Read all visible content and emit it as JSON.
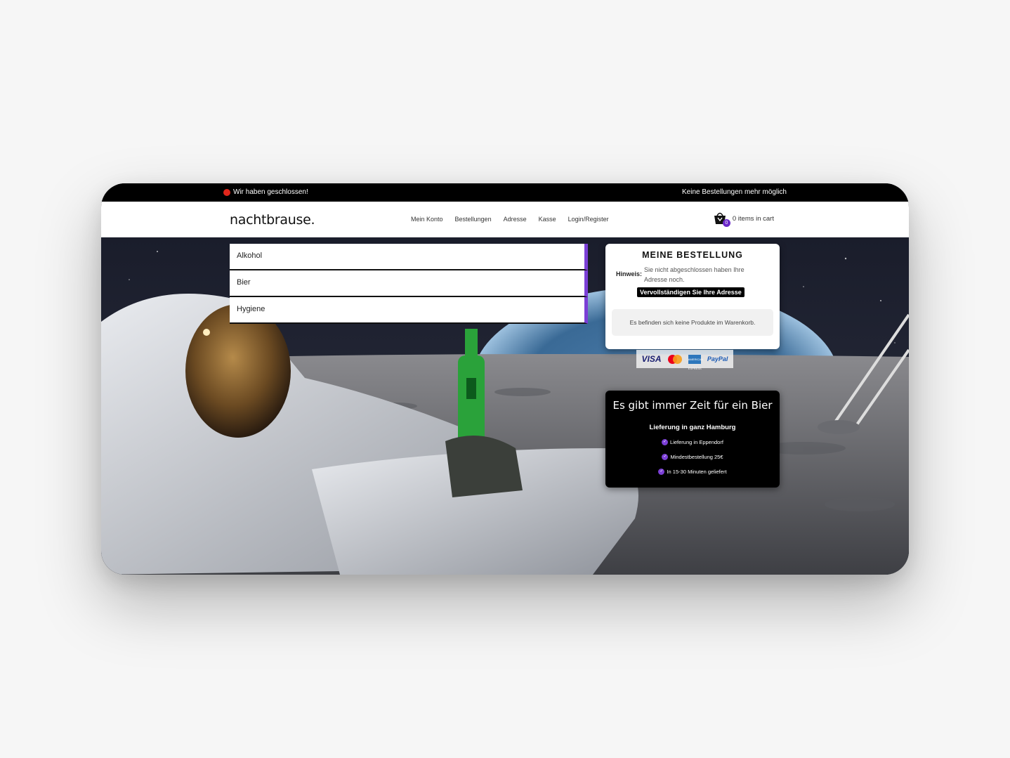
{
  "topbar": {
    "status": "Wir haben geschlossen!",
    "notice": "Keine Bestellungen mehr möglich"
  },
  "header": {
    "logo": "nachtbrause.",
    "nav": [
      "Mein Konto",
      "Bestellungen",
      "Adresse",
      "Kasse",
      "Login/Register"
    ],
    "cart": {
      "count": "0",
      "label": "0 items in cart"
    }
  },
  "categories": [
    "Alkohol",
    "Bier",
    "Hygiene"
  ],
  "order": {
    "title": "MEINE BESTELLUNG",
    "hint_label": "Hinweis:",
    "hint_text": "Sie nicht abgeschlossen haben Ihre Adresse noch.",
    "button": "Vervollständigen Sie Ihre Adresse",
    "empty": "Es befinden sich keine Produkte im Warenkorb."
  },
  "payment": {
    "visa": "VISA",
    "amex": "AMERICAN EXPRESS",
    "paypal": "PayPal"
  },
  "promo": {
    "headline": "Es gibt immer Zeit für ein Bier",
    "subtitle": "Lieferung in ganz Hamburg",
    "features": [
      "Lieferung in Eppendorf",
      "Mindestbestellung 25€",
      "In 15-30 Minuten geliefert"
    ]
  },
  "colors": {
    "accent": "#7b3fd6",
    "status": "#e0261b",
    "badge": "#6a28c9"
  },
  "icons": {
    "status": "red-dot-icon",
    "cart": "shopping-bag-icon",
    "check": "check-circle-icon"
  }
}
